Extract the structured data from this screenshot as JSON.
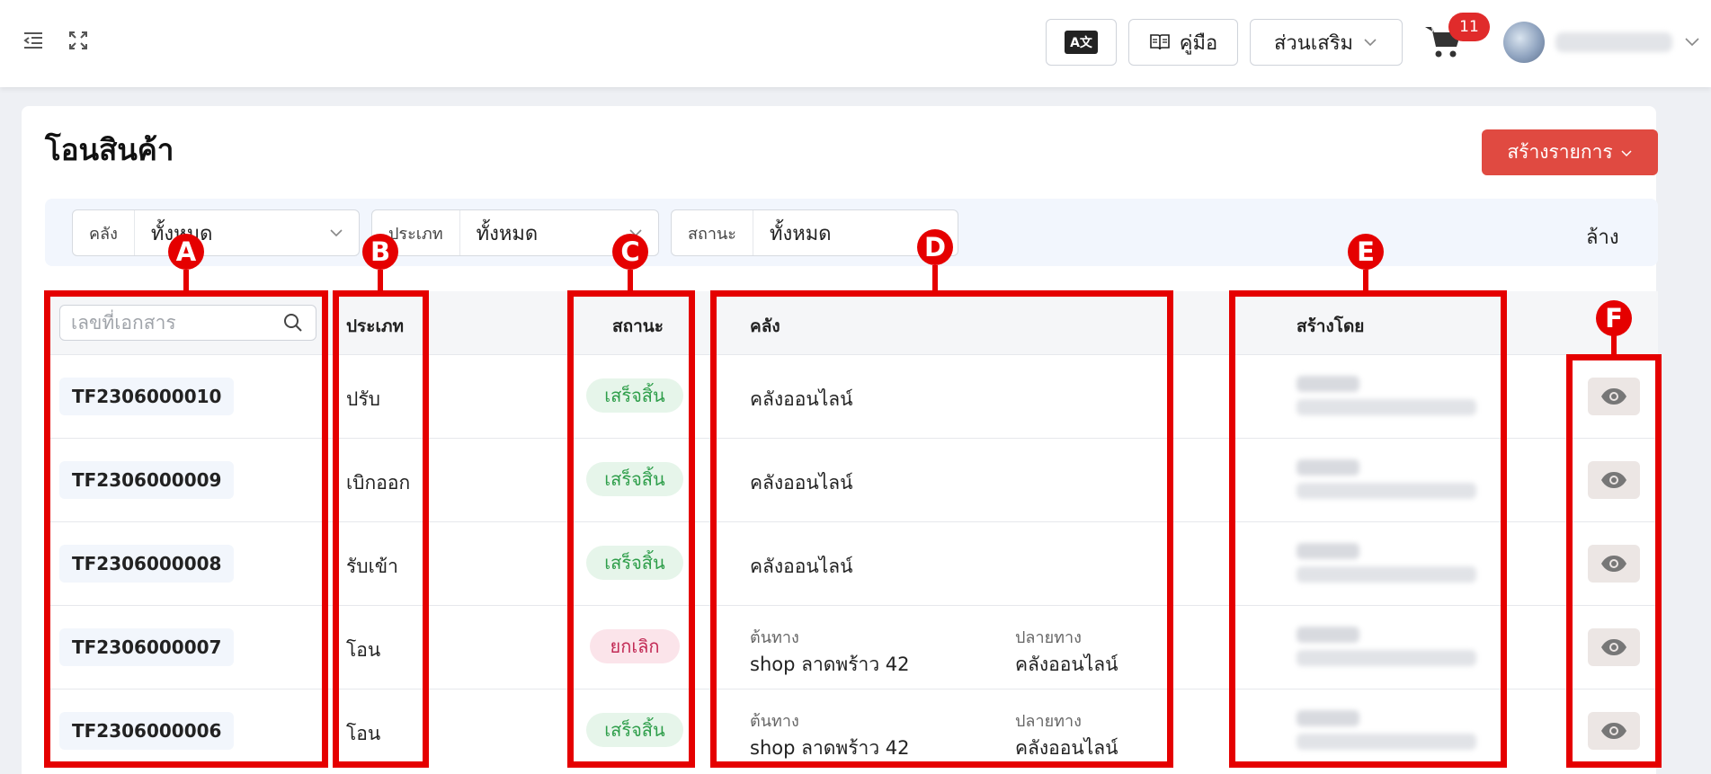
{
  "topbar": {
    "lang_label": "A文",
    "manual_label": "คู่มือ",
    "addons_label": "ส่วนเสริม",
    "cart_count": "11"
  },
  "page": {
    "title": "โอนสินค้า",
    "create_label": "สร้างรายการ"
  },
  "filters": {
    "warehouse_label": "คลัง",
    "warehouse_value": "ทั้งหมด",
    "type_label": "ประเภท",
    "type_value": "ทั้งหมด",
    "status_label": "สถานะ",
    "status_value": "ทั้งหมด",
    "clear_label": "ล้าง"
  },
  "table": {
    "search_placeholder": "เลขที่เอกสาร",
    "headers": {
      "type": "ประเภท",
      "status": "สถานะ",
      "warehouse": "คลัง",
      "created_by": "สร้างโดย"
    },
    "rows": [
      {
        "doc": "TF2306000010",
        "type": "ปรับ",
        "status": "เสร็จสิ้น",
        "warehouse": "คลังออนไลน์",
        "origin_label": "",
        "origin": "",
        "dest_label": "",
        "dest": ""
      },
      {
        "doc": "TF2306000009",
        "type": "เบิกออก",
        "status": "เสร็จสิ้น",
        "warehouse": "คลังออนไลน์",
        "origin_label": "",
        "origin": "",
        "dest_label": "",
        "dest": ""
      },
      {
        "doc": "TF2306000008",
        "type": "รับเข้า",
        "status": "เสร็จสิ้น",
        "warehouse": "คลังออนไลน์",
        "origin_label": "",
        "origin": "",
        "dest_label": "",
        "dest": ""
      },
      {
        "doc": "TF2306000007",
        "type": "โอน",
        "status": "ยกเลิก",
        "warehouse": "",
        "origin_label": "ต้นทาง",
        "origin": "shop ลาดพร้าว 42",
        "dest_label": "ปลายทาง",
        "dest": "คลังออนไลน์"
      },
      {
        "doc": "TF2306000006",
        "type": "โอน",
        "status": "เสร็จสิ้น",
        "warehouse": "",
        "origin_label": "ต้นทาง",
        "origin": "shop ลาดพร้าว 42",
        "dest_label": "ปลายทาง",
        "dest": "คลังออนไลน์"
      }
    ]
  },
  "annotations": [
    "A",
    "B",
    "C",
    "D",
    "E",
    "F"
  ],
  "colors": {
    "accent": "#e04a41",
    "annotation": "#e50000",
    "done": "#2e9e4a",
    "cancel": "#c22a55"
  }
}
